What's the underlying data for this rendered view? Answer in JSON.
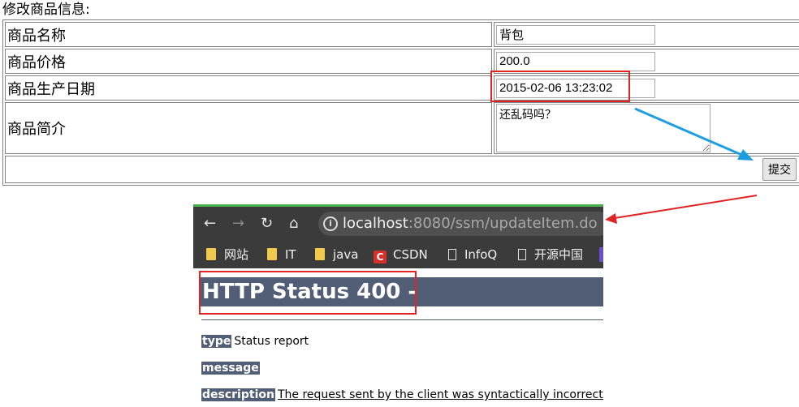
{
  "form": {
    "title": "修改商品信息:",
    "rows": [
      {
        "label": "商品名称",
        "value": "背包"
      },
      {
        "label": "商品价格",
        "value": "200.0"
      },
      {
        "label": "商品生产日期",
        "value": "2015-02-06 13:23:02"
      },
      {
        "label": "商品简介",
        "value": "还乱码吗？"
      }
    ],
    "submit_label": "提交"
  },
  "browser": {
    "url_host": "localhost",
    "url_rest": ":8080/ssm/updateItem.do",
    "bookmarks": [
      "网站",
      "IT",
      "java",
      "CSDN",
      "InfoQ",
      "开源中国"
    ],
    "page": {
      "title": "HTTP Status 400 -",
      "type_label": "type",
      "type_value": "Status report",
      "message_label": "message",
      "message_value": "",
      "description_label": "description",
      "description_value": "The request sent by the client was syntactically incorrect."
    }
  },
  "colors": {
    "highlight": "#e02424",
    "annotation_arrow": "#1e9ee0",
    "status_header": "#525d76"
  }
}
